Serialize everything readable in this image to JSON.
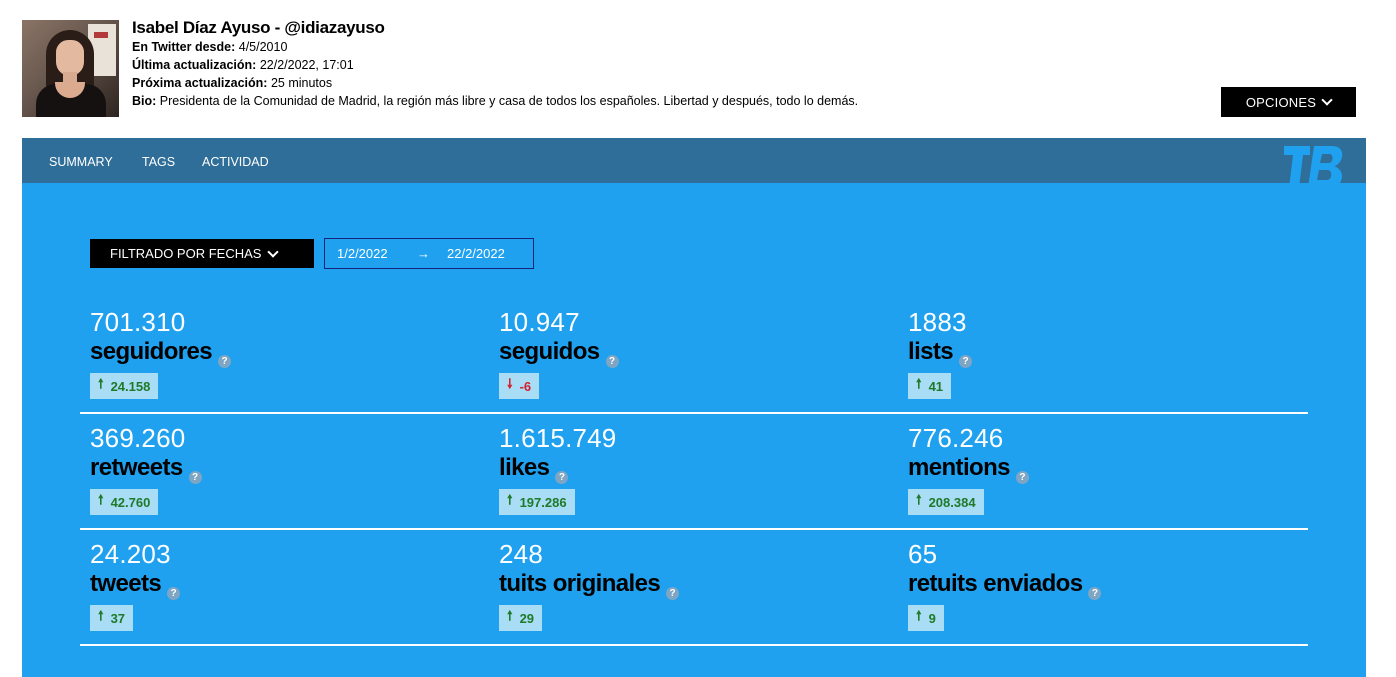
{
  "profile": {
    "name": "Isabel Díaz Ayuso - @idiazayuso",
    "twitter_since_label": "En Twitter desde:",
    "twitter_since_value": "4/5/2010",
    "last_update_label": "Última actualización:",
    "last_update_value": "22/2/2022, 17:01",
    "next_update_label": "Próxima actualización:",
    "next_update_value": "25 minutos",
    "bio_label": "Bio:",
    "bio_value": "Presidenta de la Comunidad de Madrid, la región más libre y casa de todos los españoles. Libertad y después, todo lo demás."
  },
  "options_label": "OPCIONES",
  "nav": {
    "summary": "SUMMARY",
    "tags": "TAGS",
    "actividad": "ACTIVIDAD"
  },
  "filter": {
    "label": "FILTRADO POR FECHAS",
    "date_from": "1/2/2022",
    "arrow": "→",
    "date_to": "22/2/2022"
  },
  "help_glyph": "?",
  "stats": [
    {
      "value": "701.310",
      "label": "seguidores",
      "change": "24.158",
      "direction": "up",
      "arrow": "🠕"
    },
    {
      "value": "10.947",
      "label": "seguidos",
      "change": "-6",
      "direction": "down",
      "arrow": "🠗"
    },
    {
      "value": "1883",
      "label": "lists",
      "change": "41",
      "direction": "up",
      "arrow": "🠕"
    },
    {
      "value": "369.260",
      "label": "retweets",
      "change": "42.760",
      "direction": "up",
      "arrow": "🠕"
    },
    {
      "value": "1.615.749",
      "label": "likes",
      "change": "197.286",
      "direction": "up",
      "arrow": "🠕"
    },
    {
      "value": "776.246",
      "label": "mentions",
      "change": "208.384",
      "direction": "up",
      "arrow": "🠕"
    },
    {
      "value": "24.203",
      "label": "tweets",
      "change": "37",
      "direction": "up",
      "arrow": "🠕"
    },
    {
      "value": "248",
      "label": "tuits originales",
      "change": "29",
      "direction": "up",
      "arrow": "🠕"
    },
    {
      "value": "65",
      "label": "retuits enviados",
      "change": "9",
      "direction": "up",
      "arrow": "🠕"
    }
  ],
  "colors": {
    "panel_blue": "#1fa1f0",
    "nav_blue": "#2f6e99",
    "up_green": "#1e7a28",
    "down_red": "#d2222d",
    "badge_bg": "#a9dcf5"
  }
}
